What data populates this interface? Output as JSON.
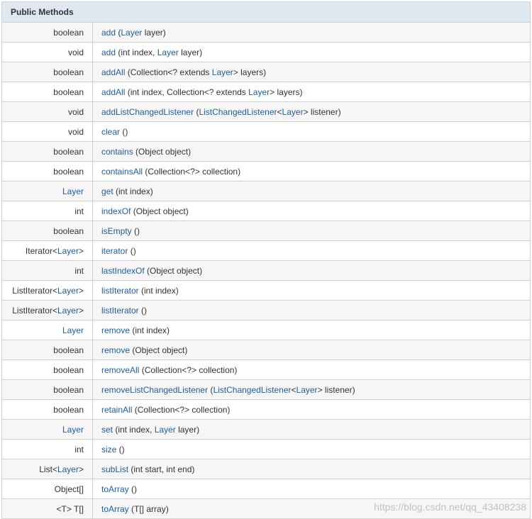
{
  "header": {
    "title": "Public Methods"
  },
  "watermark": "https://blog.csdn.net/qq_43408238",
  "colors": {
    "link": "#1d5d9c",
    "header_bg": "#dee8f1",
    "row_alt": "#f6f6f6",
    "border": "#d0d0d0"
  },
  "rows": [
    {
      "ret": [
        {
          "t": "boolean"
        }
      ],
      "sig": [
        {
          "t": "add",
          "l": 1
        },
        {
          "t": " ("
        },
        {
          "t": "Layer",
          "l": 1
        },
        {
          "t": " layer)"
        }
      ]
    },
    {
      "ret": [
        {
          "t": "void"
        }
      ],
      "sig": [
        {
          "t": "add",
          "l": 1
        },
        {
          "t": " (int index, "
        },
        {
          "t": "Layer",
          "l": 1
        },
        {
          "t": " layer)"
        }
      ]
    },
    {
      "ret": [
        {
          "t": "boolean"
        }
      ],
      "sig": [
        {
          "t": "addAll",
          "l": 1
        },
        {
          "t": " (Collection<? extends "
        },
        {
          "t": "Layer",
          "l": 1
        },
        {
          "t": "> layers)"
        }
      ]
    },
    {
      "ret": [
        {
          "t": "boolean"
        }
      ],
      "sig": [
        {
          "t": "addAll",
          "l": 1
        },
        {
          "t": " (int index, Collection<? extends "
        },
        {
          "t": "Layer",
          "l": 1
        },
        {
          "t": "> layers)"
        }
      ]
    },
    {
      "ret": [
        {
          "t": "void"
        }
      ],
      "sig": [
        {
          "t": "addListChangedListener",
          "l": 1
        },
        {
          "t": " ("
        },
        {
          "t": "ListChangedListener",
          "l": 1
        },
        {
          "t": "<"
        },
        {
          "t": "Layer",
          "l": 1
        },
        {
          "t": "> listener)"
        }
      ]
    },
    {
      "ret": [
        {
          "t": "void"
        }
      ],
      "sig": [
        {
          "t": "clear",
          "l": 1
        },
        {
          "t": " ()"
        }
      ]
    },
    {
      "ret": [
        {
          "t": "boolean"
        }
      ],
      "sig": [
        {
          "t": "contains",
          "l": 1
        },
        {
          "t": " (Object object)"
        }
      ]
    },
    {
      "ret": [
        {
          "t": "boolean"
        }
      ],
      "sig": [
        {
          "t": "containsAll",
          "l": 1
        },
        {
          "t": " (Collection<?> collection)"
        }
      ]
    },
    {
      "ret": [
        {
          "t": "Layer",
          "l": 1
        }
      ],
      "sig": [
        {
          "t": "get",
          "l": 1
        },
        {
          "t": " (int index)"
        }
      ]
    },
    {
      "ret": [
        {
          "t": "int"
        }
      ],
      "sig": [
        {
          "t": "indexOf",
          "l": 1
        },
        {
          "t": " (Object object)"
        }
      ]
    },
    {
      "ret": [
        {
          "t": "boolean"
        }
      ],
      "sig": [
        {
          "t": "isEmpty",
          "l": 1
        },
        {
          "t": " ()"
        }
      ]
    },
    {
      "ret": [
        {
          "t": "Iterator<"
        },
        {
          "t": "Layer",
          "l": 1
        },
        {
          "t": ">"
        }
      ],
      "sig": [
        {
          "t": "iterator",
          "l": 1
        },
        {
          "t": " ()"
        }
      ]
    },
    {
      "ret": [
        {
          "t": "int"
        }
      ],
      "sig": [
        {
          "t": "lastIndexOf",
          "l": 1
        },
        {
          "t": " (Object object)"
        }
      ]
    },
    {
      "ret": [
        {
          "t": "ListIterator<"
        },
        {
          "t": "Layer",
          "l": 1
        },
        {
          "t": ">"
        }
      ],
      "sig": [
        {
          "t": "listIterator",
          "l": 1
        },
        {
          "t": " (int index)"
        }
      ]
    },
    {
      "ret": [
        {
          "t": "ListIterator<"
        },
        {
          "t": "Layer",
          "l": 1
        },
        {
          "t": ">"
        }
      ],
      "sig": [
        {
          "t": "listIterator",
          "l": 1
        },
        {
          "t": " ()"
        }
      ]
    },
    {
      "ret": [
        {
          "t": "Layer",
          "l": 1
        }
      ],
      "sig": [
        {
          "t": "remove",
          "l": 1
        },
        {
          "t": " (int index)"
        }
      ]
    },
    {
      "ret": [
        {
          "t": "boolean"
        }
      ],
      "sig": [
        {
          "t": "remove",
          "l": 1
        },
        {
          "t": " (Object object)"
        }
      ]
    },
    {
      "ret": [
        {
          "t": "boolean"
        }
      ],
      "sig": [
        {
          "t": "removeAll",
          "l": 1
        },
        {
          "t": " (Collection<?> collection)"
        }
      ]
    },
    {
      "ret": [
        {
          "t": "boolean"
        }
      ],
      "sig": [
        {
          "t": "removeListChangedListener",
          "l": 1
        },
        {
          "t": " ("
        },
        {
          "t": "ListChangedListener",
          "l": 1
        },
        {
          "t": "<"
        },
        {
          "t": "Layer",
          "l": 1
        },
        {
          "t": "> listener)"
        }
      ]
    },
    {
      "ret": [
        {
          "t": "boolean"
        }
      ],
      "sig": [
        {
          "t": "retainAll",
          "l": 1
        },
        {
          "t": " (Collection<?> collection)"
        }
      ]
    },
    {
      "ret": [
        {
          "t": "Layer",
          "l": 1
        }
      ],
      "sig": [
        {
          "t": "set",
          "l": 1
        },
        {
          "t": " (int index, "
        },
        {
          "t": "Layer",
          "l": 1
        },
        {
          "t": " layer)"
        }
      ]
    },
    {
      "ret": [
        {
          "t": "int"
        }
      ],
      "sig": [
        {
          "t": "size",
          "l": 1
        },
        {
          "t": " ()"
        }
      ]
    },
    {
      "ret": [
        {
          "t": "List<"
        },
        {
          "t": "Layer",
          "l": 1
        },
        {
          "t": ">"
        }
      ],
      "sig": [
        {
          "t": "subList",
          "l": 1
        },
        {
          "t": " (int start, int end)"
        }
      ]
    },
    {
      "ret": [
        {
          "t": "Object[]"
        }
      ],
      "sig": [
        {
          "t": "toArray",
          "l": 1
        },
        {
          "t": " ()"
        }
      ]
    },
    {
      "ret": [
        {
          "t": "<T> T[]"
        }
      ],
      "sig": [
        {
          "t": "toArray",
          "l": 1
        },
        {
          "t": " (T[] array)"
        }
      ]
    }
  ]
}
